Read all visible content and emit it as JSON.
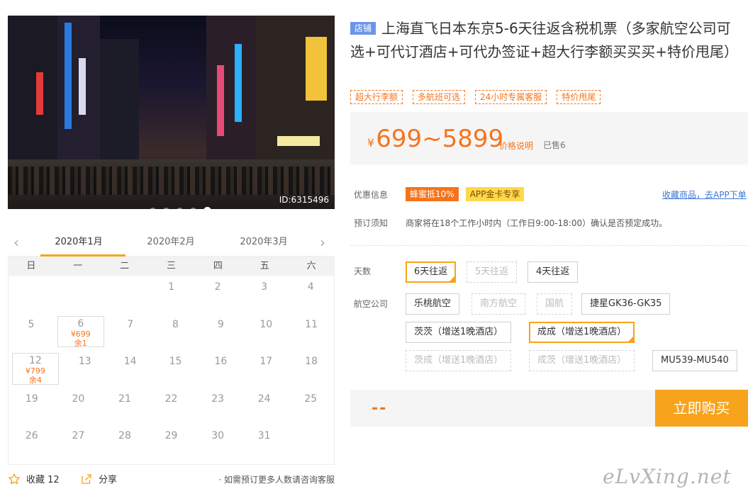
{
  "gallery": {
    "image_id": "ID:6315496",
    "dot_count": 5,
    "active_dot": 5
  },
  "calendar": {
    "months": [
      "2020年1月",
      "2020年2月",
      "2020年3月"
    ],
    "active_month": "2020年1月",
    "weekdays": [
      "日",
      "一",
      "二",
      "三",
      "四",
      "五",
      "六"
    ],
    "weeks": [
      [
        {
          "d": ""
        },
        {
          "d": ""
        },
        {
          "d": ""
        },
        {
          "d": "1"
        },
        {
          "d": "2"
        },
        {
          "d": "3"
        },
        {
          "d": "4"
        }
      ],
      [
        {
          "d": "5"
        },
        {
          "d": "6",
          "price": "¥699",
          "stock": "余1"
        },
        {
          "d": "7"
        },
        {
          "d": "8"
        },
        {
          "d": "9"
        },
        {
          "d": "10"
        },
        {
          "d": "11"
        }
      ],
      [
        {
          "d": "12",
          "price": "¥799",
          "stock": "余4"
        },
        {
          "d": "13"
        },
        {
          "d": "14"
        },
        {
          "d": "15"
        },
        {
          "d": "16"
        },
        {
          "d": "17"
        },
        {
          "d": "18"
        }
      ],
      [
        {
          "d": "19"
        },
        {
          "d": "20"
        },
        {
          "d": "21"
        },
        {
          "d": "22"
        },
        {
          "d": "23"
        },
        {
          "d": "24"
        },
        {
          "d": "25"
        }
      ],
      [
        {
          "d": "26"
        },
        {
          "d": "27"
        },
        {
          "d": "28"
        },
        {
          "d": "29"
        },
        {
          "d": "30"
        },
        {
          "d": "31"
        },
        {
          "d": ""
        }
      ]
    ]
  },
  "actions": {
    "favorite_label": "收藏 12",
    "share_label": "分享",
    "note": "· 如需预订更多人数请咨询客服"
  },
  "product": {
    "shop_badge": "店铺",
    "title": "上海直飞日本东京5-6天往返含税机票（多家航空公司可选+可代订酒店+可代办签证+超大行李额买买买+特价甩尾）",
    "tags": [
      "超大行李额",
      "多航班可选",
      "24小时专属客服",
      "特价甩尾"
    ]
  },
  "price": {
    "currency": "¥",
    "range": "699~5899",
    "note": "价格说明",
    "sold": "已售6"
  },
  "promotion": {
    "label": "优惠信息",
    "badges": [
      "蜂蜜抵10%",
      "APP金卡专享"
    ],
    "fav_link": "收藏商品，去APP下单"
  },
  "booking": {
    "label": "预订须知",
    "text": "商家将在18个工作小时内（工作日9:00-18:00）确认是否预定成功。"
  },
  "options": {
    "days_label": "天数",
    "days": [
      {
        "label": "6天往返",
        "state": "selected"
      },
      {
        "label": "5天往返",
        "state": "disabled"
      },
      {
        "label": "4天往返",
        "state": "normal"
      }
    ],
    "airline_label": "航空公司",
    "airlines": [
      {
        "label": "乐桃航空",
        "state": "normal"
      },
      {
        "label": "南方航空",
        "state": "disabled"
      },
      {
        "label": "国航",
        "state": "disabled"
      },
      {
        "label": "捷星GK36-GK35",
        "state": "normal"
      },
      {
        "label": "茨茨（增送1晚酒店）",
        "state": "normal"
      },
      {
        "label": "成成（增送1晚酒店）",
        "state": "selected"
      },
      {
        "label": "茨成（增送1晚酒店）",
        "state": "disabled"
      },
      {
        "label": "成茨（增送1晚酒店）",
        "state": "disabled"
      },
      {
        "label": "MU539-MU540",
        "state": "normal"
      }
    ]
  },
  "purchase": {
    "quantity": "--",
    "buy_label": "立即购买"
  },
  "watermark": "eLvXing.net",
  "colors": {
    "accent": "#f7731b",
    "button": "#f7a31b",
    "badge_blue": "#6d95e7",
    "link": "#3a76d3"
  }
}
